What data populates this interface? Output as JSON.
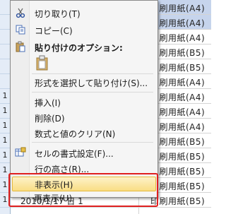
{
  "sheet": {
    "rows": [
      {
        "num": "",
        "date": "",
        "item": "印刷用紙(A4)",
        "selected": true
      },
      {
        "num": "",
        "date": "",
        "item": "印刷用紙(A4)",
        "selected": true
      },
      {
        "num": "",
        "date": "",
        "item": "印刷用紙(A4)",
        "selected": false
      },
      {
        "num": "",
        "date": "",
        "item": "印刷用紙(B5)",
        "selected": false
      },
      {
        "num": "",
        "date": "",
        "item": "印刷用紙(B5)",
        "selected": false
      },
      {
        "num": "",
        "date": "",
        "item": "印刷用紙(A4)",
        "selected": false
      },
      {
        "num": "1",
        "date": "",
        "item": "印刷用紙(A4)",
        "selected": false
      },
      {
        "num": "1",
        "date": "",
        "item": "印刷用紙(A4)",
        "selected": false
      },
      {
        "num": "1",
        "date": "",
        "item": "印刷用紙(A4)",
        "selected": false
      },
      {
        "num": "1",
        "date": "",
        "item": "印刷用紙(B5)",
        "selected": false
      },
      {
        "num": "1",
        "date": "",
        "item": "印刷用紙(B5)",
        "selected": false
      },
      {
        "num": "1",
        "date": "",
        "item": "印刷用紙(B5)",
        "selected": false
      },
      {
        "num": "1",
        "date": "",
        "item": "印刷用紙(B5)",
        "selected": false
      },
      {
        "num": "1",
        "date": "2010/1/17 日 1",
        "item": "印刷用紙(B5)",
        "selected": false
      }
    ]
  },
  "menu": {
    "cut": "切り取り(T)",
    "copy": "コピー(C)",
    "paste_options": "貼り付けのオプション:",
    "paste_special": "形式を選択して貼り付け(S)...",
    "insert": "挿入(I)",
    "delete": "削除(D)",
    "clear_contents": "数式と値のクリア(N)",
    "format_cells": "セルの書式設定(F)...",
    "row_height": "行の高さ(R)...",
    "hide": "非表示(H)",
    "unhide": "再表示(U)"
  },
  "icons": {
    "cut": "scissors-icon",
    "copy": "copy-icon",
    "paste_options": "clipboard-icon",
    "paste": "paste-icon",
    "format_cells": "format-cells-icon"
  },
  "colors": {
    "highlight_box": "#e02020",
    "hover_fill": "#f9dd84",
    "selection": "#c6d4ec"
  }
}
